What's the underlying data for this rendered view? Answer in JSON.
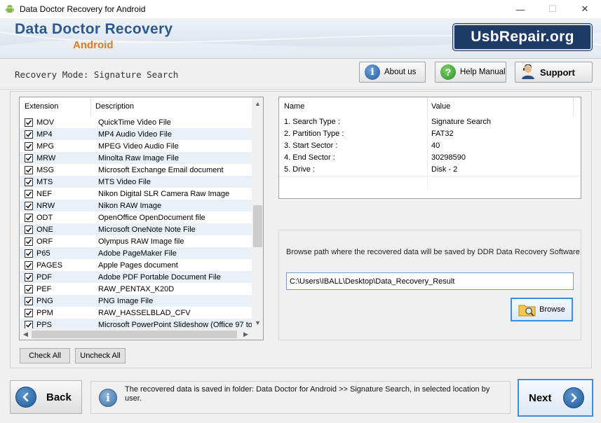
{
  "window": {
    "title": "Data Doctor Recovery for Android",
    "minimize": "—",
    "maximize": "☐",
    "close": "✕"
  },
  "banner": {
    "brand": "Data Doctor Recovery",
    "subtitle": "Android",
    "logo": "UsbRepair.org"
  },
  "mode": {
    "label": "Recovery Mode: Signature Search"
  },
  "toolbar": {
    "about": "About us",
    "help": "Help Manual",
    "support": "Support"
  },
  "extensions": {
    "headers": {
      "extension": "Extension",
      "description": "Description"
    },
    "rows": [
      {
        "ext": "MOV",
        "desc": "QuickTime Video File",
        "checked": true
      },
      {
        "ext": "MP4",
        "desc": "MP4 Audio Video File",
        "checked": true
      },
      {
        "ext": "MPG",
        "desc": "MPEG Video Audio File",
        "checked": true
      },
      {
        "ext": "MRW",
        "desc": "Minolta Raw Image File",
        "checked": true
      },
      {
        "ext": "MSG",
        "desc": "Microsoft Exchange Email document",
        "checked": true
      },
      {
        "ext": "MTS",
        "desc": "MTS Video File",
        "checked": true
      },
      {
        "ext": "NEF",
        "desc": "Nikon Digital SLR Camera Raw Image",
        "checked": true
      },
      {
        "ext": "NRW",
        "desc": "Nikon RAW Image",
        "checked": true
      },
      {
        "ext": "ODT",
        "desc": "OpenOffice OpenDocument file",
        "checked": true
      },
      {
        "ext": "ONE",
        "desc": "Microsoft OneNote Note File",
        "checked": true
      },
      {
        "ext": "ORF",
        "desc": "Olympus RAW Image file",
        "checked": true
      },
      {
        "ext": "P65",
        "desc": "Adobe PageMaker File",
        "checked": true
      },
      {
        "ext": "PAGES",
        "desc": "Apple Pages document",
        "checked": true
      },
      {
        "ext": "PDF",
        "desc": "Adobe PDF Portable Document File",
        "checked": true
      },
      {
        "ext": "PEF",
        "desc": "RAW_PENTAX_K20D",
        "checked": true
      },
      {
        "ext": "PNG",
        "desc": "PNG Image File",
        "checked": true
      },
      {
        "ext": "PPM",
        "desc": "RAW_HASSELBLAD_CFV",
        "checked": true
      },
      {
        "ext": "PPS",
        "desc": "Microsoft PowerPoint Slideshow (Office 97 to...",
        "checked": true
      }
    ],
    "check_all": "Check All",
    "uncheck_all": "Uncheck All"
  },
  "info": {
    "headers": {
      "name": "Name",
      "value": "Value"
    },
    "rows": [
      {
        "name": "1. Search Type :",
        "value": "Signature Search"
      },
      {
        "name": "2. Partition Type :",
        "value": "FAT32"
      },
      {
        "name": "3. Start Sector :",
        "value": "40"
      },
      {
        "name": "4. End Sector :",
        "value": "30298590"
      },
      {
        "name": "5. Drive :",
        "value": "Disk - 2"
      }
    ]
  },
  "browse": {
    "prompt": "Browse path where the recovered data will be saved by DDR Data Recovery Software",
    "path": "C:\\Users\\IBALL\\Desktop\\Data_Recovery_Result",
    "button": "Browse"
  },
  "footer": {
    "back": "Back",
    "next": "Next",
    "status": "The recovered data is saved in folder: Data Doctor for Android  >> Signature Search, in selected location by user."
  },
  "colors": {
    "brand_blue": "#2b5a8e",
    "brand_orange": "#e07b1c",
    "focus_blue": "#3d8ee0",
    "row_alt": "#e9f0f8"
  }
}
